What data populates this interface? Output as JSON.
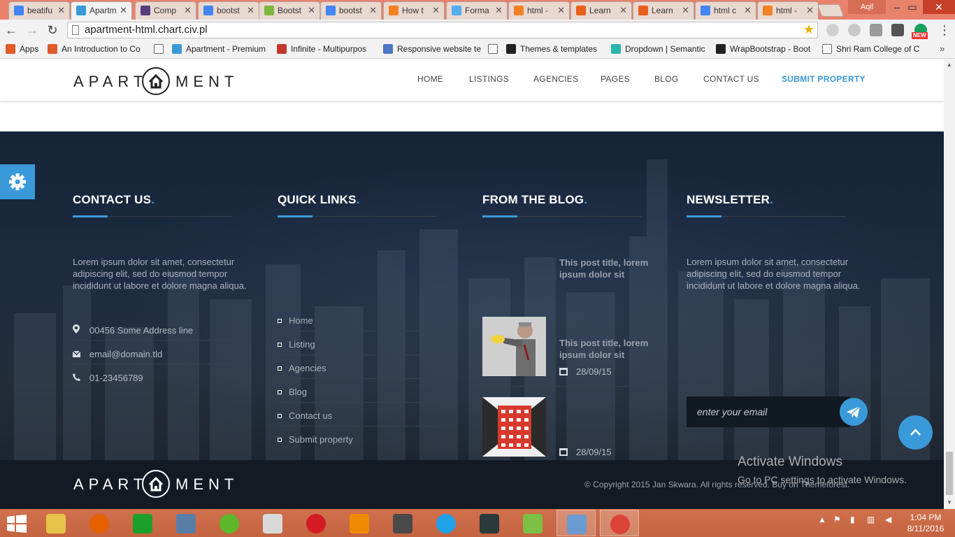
{
  "browser": {
    "tabs": [
      {
        "label": "beatifu",
        "icon": "google-icon",
        "color": "#4285f4"
      },
      {
        "label": "Apartm",
        "icon": "house-icon",
        "color": "#3a9ad9",
        "active": true
      },
      {
        "label": "Comp",
        "icon": "bootstrap-icon",
        "color": "#563d7c"
      },
      {
        "label": "bootst",
        "icon": "google-icon",
        "color": "#4285f4"
      },
      {
        "label": "Bootst",
        "icon": "wrapbootstrap-icon",
        "color": "#79b83b"
      },
      {
        "label": "bootst",
        "icon": "google-icon",
        "color": "#4285f4"
      },
      {
        "label": "How t",
        "icon": "stackoverflow-icon",
        "color": "#f48024"
      },
      {
        "label": "Forma",
        "icon": "twitter-icon",
        "color": "#55acee"
      },
      {
        "label": "html -",
        "icon": "stackoverflow-icon",
        "color": "#f48024"
      },
      {
        "label": "Learn",
        "icon": "w3schools-icon",
        "color": "#e8601a"
      },
      {
        "label": "Learn",
        "icon": "w3schools-icon",
        "color": "#e8601a"
      },
      {
        "label": "html c",
        "icon": "google-icon",
        "color": "#4285f4"
      },
      {
        "label": "html -",
        "icon": "stackoverflow-icon",
        "color": "#f48024"
      }
    ],
    "user": "Aqil",
    "url": "apartment-html.chart.civ.pl",
    "ext_badge": "NEW",
    "bookmarks": [
      {
        "label": "Apps",
        "icon": "apps-grid-icon",
        "color": "#e05a2a"
      },
      {
        "label": "An Introduction to Co",
        "icon": "plus-icon",
        "color": "#e05a2a"
      },
      {
        "label": "",
        "icon": "page-icon",
        "color": "#ffffff"
      },
      {
        "label": "Apartment - Premium",
        "icon": "house-icon",
        "color": "#3a9ad9"
      },
      {
        "label": "Infinite - Multipurpos",
        "icon": "wp-icon",
        "color": "#c0392b"
      },
      {
        "label": "Responsive website te",
        "icon": "shield-icon",
        "color": "#4a78c2"
      },
      {
        "label": "",
        "icon": "page-icon",
        "color": "#ffffff"
      },
      {
        "label": "Themes & templates",
        "icon": "wrapbootstrap-icon",
        "color": "#222222"
      },
      {
        "label": "Dropdown | Semantic",
        "icon": "semantic-icon",
        "color": "#2ab7a9"
      },
      {
        "label": "WrapBootstrap - Boot",
        "icon": "wrapbootstrap-icon",
        "color": "#222222"
      },
      {
        "label": "Shri Ram College of C",
        "icon": "page-icon",
        "color": "#ffffff"
      }
    ]
  },
  "site": {
    "logo_left": "APART",
    "logo_right": "MENT",
    "nav": [
      "HOME",
      "LISTINGS",
      "AGENCIES",
      "PAGES",
      "BLOG",
      "CONTACT US",
      "SUBMIT PROPERTY"
    ],
    "accent_color": "#3a9ad9"
  },
  "footer": {
    "contact": {
      "title": "CONTACT US",
      "text": "Lorem ipsum dolor sit amet, consectetur adipiscing elit, sed do eiusmod tempor incididunt ut labore et dolore magna aliqua.",
      "address": "00456 Some Address line",
      "email": "email@domain.tld",
      "phone": "01-23456789"
    },
    "quick_links": {
      "title": "QUICK LINKS",
      "items": [
        "Home",
        "Listing",
        "Agencies",
        "Blog",
        "Contact us",
        "Submit property"
      ]
    },
    "blog": {
      "title": "FROM THE BLOG",
      "posts": [
        {
          "title": "This post title, lorem ipsum dolor sit",
          "date": "28/09/15"
        },
        {
          "title": "This post title, lorem ipsum dolor sit",
          "date": "28/09/15"
        }
      ]
    },
    "newsletter": {
      "title": "NEWSLETTER",
      "text": "Lorem ipsum dolor sit amet, consectetur adipiscing elit, sed do eiusmod tempor incididunt ut labore et dolore magna aliqua.",
      "placeholder": "enter your email"
    },
    "dot": ".",
    "copyright": "© Copyright 2015 Jan Skwara. All rights reserved. Buy on Themeforest."
  },
  "watermark": {
    "line1": "Activate Windows",
    "line2": "Go to PC settings to activate Windows."
  },
  "taskbar": {
    "time": "1:04 PM",
    "date": "8/11/2016"
  }
}
